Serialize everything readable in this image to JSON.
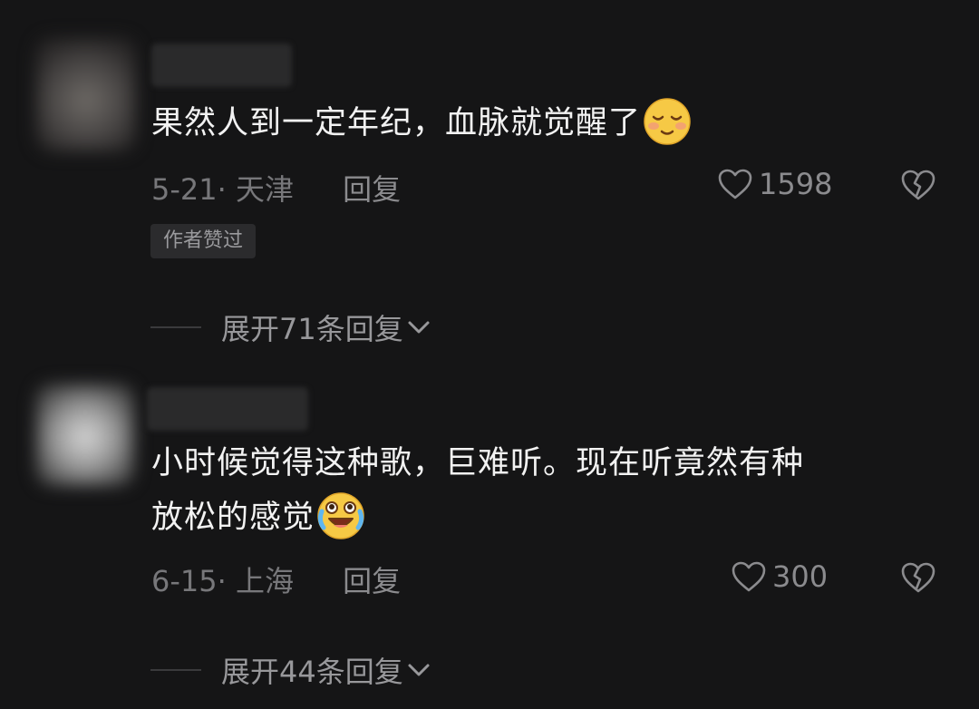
{
  "comments": [
    {
      "text": "果然人到一定年纪，血脉就觉醒了",
      "emoji_icon": "smiling-relieved-emoji",
      "date": "5-21",
      "location": "天津",
      "reply_label": "回复",
      "likes": "1598",
      "badge": "作者赞过",
      "expand_label": "展开71条回复"
    },
    {
      "text_line1": "小时候觉得这种歌，巨难听。现在听竟然有种",
      "text_line2": "放松的感觉",
      "emoji_icon": "crying-laughing-emoji",
      "date": "6-15",
      "location": "上海",
      "reply_label": "回复",
      "likes": "300",
      "expand_label": "展开44条回复"
    }
  ],
  "colors": {
    "background": "#151516",
    "text_primary": "#f2f2f2",
    "text_secondary": "#77777a",
    "badge_bg": "#2b2b2d"
  }
}
